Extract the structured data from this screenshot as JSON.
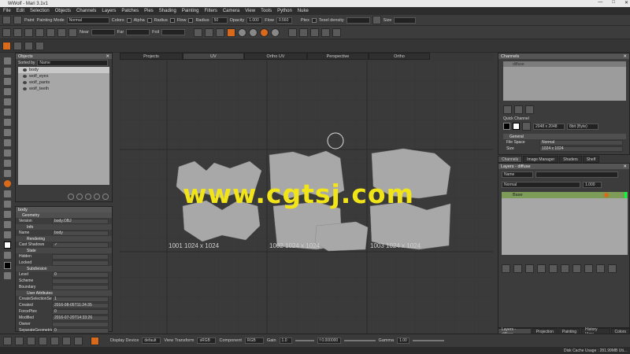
{
  "window": {
    "title": "WWolf - Mari 3.1v1",
    "controls": [
      "—",
      "□",
      "✕"
    ]
  },
  "menu": [
    "File",
    "Edit",
    "Selection",
    "Objects",
    "Channels",
    "Layers",
    "Patches",
    "Pies",
    "Shading",
    "Painting",
    "Filters",
    "Camera",
    "View",
    "Tools",
    "Python",
    "Nuke"
  ],
  "toolbar1": {
    "paint": "Paint",
    "painting_mode_label": "Painting Mode",
    "painting_mode": "Normal",
    "colors": "Colors",
    "alpha": "Alpha",
    "radius_label": "Radius",
    "flow": "Flow",
    "radius_label2": "Radius",
    "radius_value": "50",
    "opacity_label": "Opacity",
    "opacity_value": "1.000",
    "flow_label": "Flow",
    "flow_value": "0.560",
    "ptex": "Ptex",
    "texel_label": "Texel density",
    "size_label": "Size"
  },
  "toolbar2": {
    "near": "Near",
    "far": "Far",
    "foil": "Foil"
  },
  "objects_panel": {
    "title": "Objects",
    "sorted_by_label": "Sorted by",
    "sorted_by_value": "Name",
    "items": [
      "body",
      "wolf_eyes",
      "wolf_pants",
      "wolf_teeth"
    ]
  },
  "properties_panel": {
    "object": "body",
    "rows": [
      {
        "type": "section",
        "label": "Geometry"
      },
      {
        "k": "Version",
        "v": "body.OBJ"
      },
      {
        "type": "sub",
        "label": "Info"
      },
      {
        "k": "Name",
        "v": "body"
      },
      {
        "type": "sub",
        "label": "Rendering"
      },
      {
        "k": "Cast Shadows",
        "v": "✓"
      },
      {
        "type": "sub",
        "label": "State"
      },
      {
        "k": "Hidden",
        "v": ""
      },
      {
        "k": "Locked",
        "v": ""
      },
      {
        "type": "sub",
        "label": "Subdivision"
      },
      {
        "k": "Level",
        "v": "0"
      },
      {
        "k": "Scheme",
        "v": ""
      },
      {
        "k": "Boundary",
        "v": ""
      },
      {
        "type": "sub",
        "label": "User Attributes"
      },
      {
        "k": "CreateSelectionSets",
        "v": "1"
      },
      {
        "k": "Created",
        "v": "2016-08-05T11:24:35"
      },
      {
        "k": "ForcePtex",
        "v": "0"
      },
      {
        "k": "Modified",
        "v": "2016-07-20T14:33:26"
      },
      {
        "k": "Owner",
        "v": ""
      },
      {
        "k": "SeparateGeometries",
        "v": "0"
      }
    ]
  },
  "viewport": {
    "tabs": [
      "Projects",
      "UV",
      "Ortho UV",
      "Perspective",
      "Ortho"
    ],
    "active_tab": "UV",
    "uv_labels": [
      "1001 1024 x 1024",
      "1002 1024 x 1024",
      "1003 1024 x 1024"
    ],
    "watermark": "www.cgtsj.com"
  },
  "channels_panel": {
    "title": "Channels",
    "selected": "diffuse",
    "quick_channel_label": "Quick Channel",
    "size_value": "2048 x 2048",
    "depth_value": "8bit (Byte)",
    "general_label": "General",
    "file_space_label": "File Space",
    "file_space_value": "Normal",
    "size_label": "Size",
    "size_field": "1024 x 1024"
  },
  "right_tabs": [
    "Channels",
    "Image Manager",
    "Shaders",
    "Shelf"
  ],
  "layers_panel": {
    "title": "Layers - diffuse",
    "filter_label": "Name",
    "blend_mode": "Normal",
    "opacity": "1.000",
    "layer": "Base"
  },
  "bottom_tabs": [
    "Layers - diffuse",
    "Projection",
    "Painting",
    "History View",
    "Colors"
  ],
  "bottom_toolbar": {
    "display_device_label": "Display Device",
    "display_device": "default",
    "view_transform_label": "View Transform",
    "view_transform": "sRGB",
    "component_label": "Component",
    "component": "RGB",
    "gain_label": "Gain",
    "gain": "1.0",
    "fstop": "f 0.000000",
    "gamma_label": "Gamma",
    "gamma": "1.00"
  },
  "status": "Disk Cache Usage : 281.99MB Uti..."
}
